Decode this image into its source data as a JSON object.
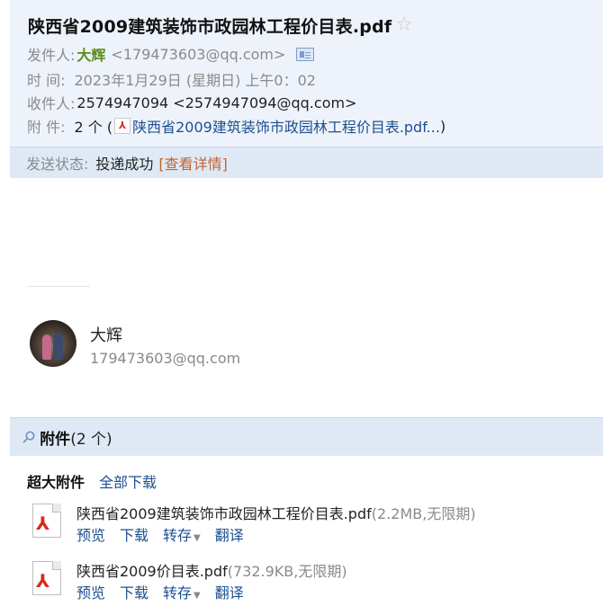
{
  "header": {
    "subject": "陕西省2009建筑装饰市政园林工程价目表.pdf",
    "star_icon": "star-outline-icon",
    "from_label": "发件人:",
    "from_name": "大辉",
    "from_email": "<179473603@qq.com>",
    "time_label": "时 间:",
    "time_value": "2023年1月29日 (星期日) 上午0：02",
    "to_label": "收件人:",
    "to_value": "2574947094 <2574947094@qq.com>",
    "attach_label": "附 件:",
    "attach_count": "2 个 (",
    "attach_first": "陕西省2009建筑装饰市政园林工程价目表.pdf...",
    "attach_close": ")"
  },
  "status": {
    "label": "发送状态:",
    "value": "投递成功",
    "details_link": "[查看详情]"
  },
  "signature": {
    "name": "大辉",
    "email": "179473603@qq.com"
  },
  "attachments": {
    "title": "附件",
    "count": "(2 个)",
    "big_label": "超大附件",
    "download_all": "全部下载",
    "files": [
      {
        "name": "陕西省2009建筑装饰市政园林工程价目表.pdf",
        "meta": "(2.2MB,无限期)",
        "actions": {
          "preview": "预览",
          "download": "下载",
          "save": "转存",
          "translate": "翻译"
        }
      },
      {
        "name": "陕西省2009价目表.pdf",
        "meta": "(732.9KB,无限期)",
        "actions": {
          "preview": "预览",
          "download": "下载",
          "save": "转存",
          "translate": "翻译"
        }
      }
    ]
  },
  "colors": {
    "header_bg": "#eef3fb",
    "bar_bg": "#dfe9f6",
    "link": "#1e4f8f",
    "sender_green": "#5b8d1c",
    "status_link": "#c0642c",
    "pdf_red": "#d62a1d"
  }
}
